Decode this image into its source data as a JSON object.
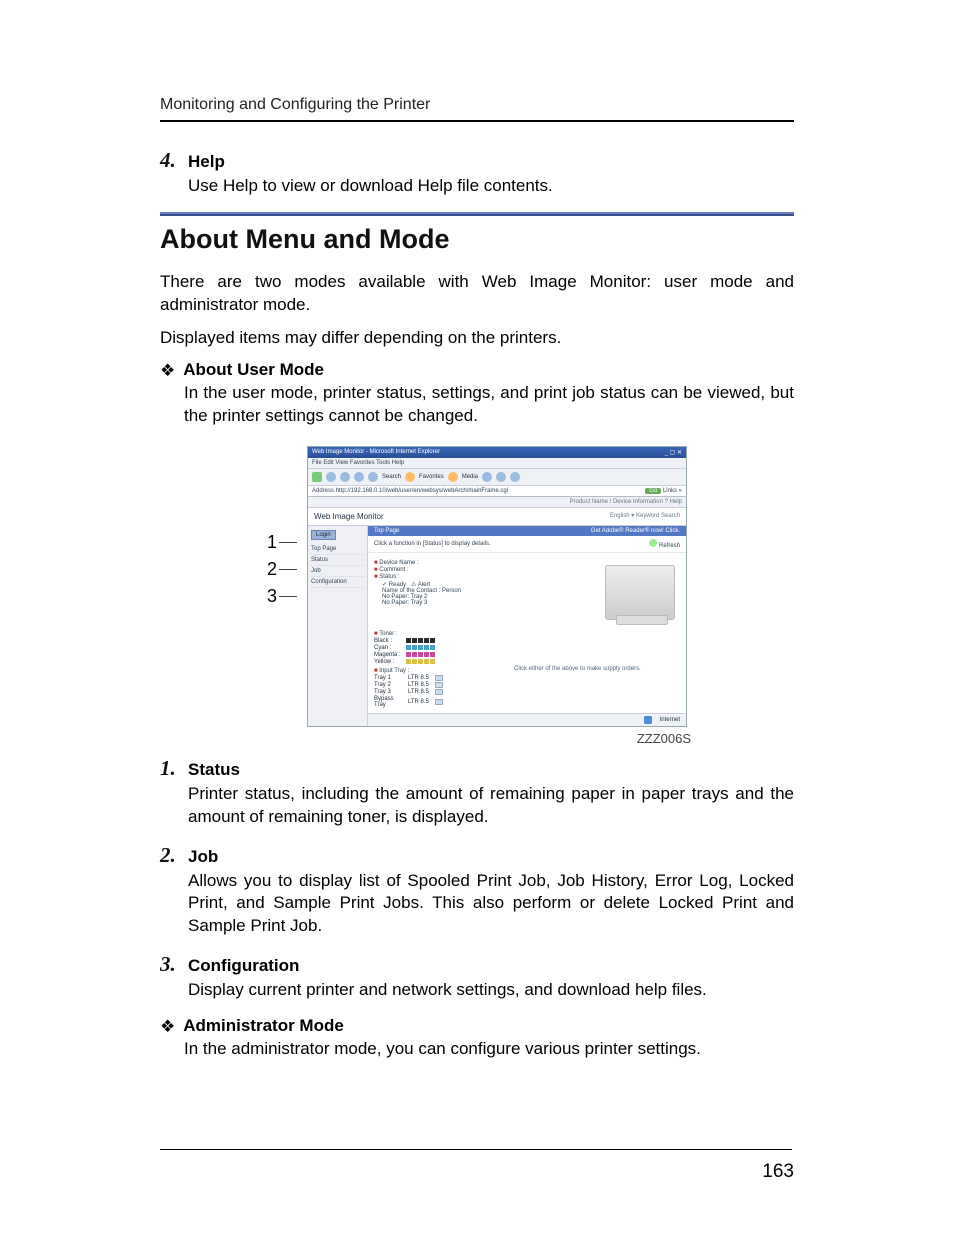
{
  "header": {
    "title": "Monitoring and Configuring the Printer"
  },
  "topItem": {
    "num": "4.",
    "title": "Help",
    "body": "Use Help to view or download Help file contents."
  },
  "section": {
    "title": "About Menu and Mode",
    "para1": "There are two modes available with Web Image Monitor: user mode and administrator mode.",
    "para2": "Displayed items may differ depending on the printers."
  },
  "userMode": {
    "title": "About User Mode",
    "body": "In the user mode, printer status, settings, and print job status can be viewed, but the printer settings cannot be changed."
  },
  "callouts": {
    "c1": "1",
    "c2": "2",
    "c3": "3"
  },
  "browser": {
    "title": "Web Image Monitor - Microsoft Internet Explorer",
    "menus": "File   Edit   View   Favorites   Tools   Help",
    "search": "Search",
    "favorites": "Favorites",
    "media": "Media",
    "url": "Address  http://192.168.0.10/web/user/en/websys/webArch/mainFrame.cgi",
    "go": "Go",
    "links": "Links",
    "hostline": "Product Name / Device Information       ? Help",
    "appTitle": "Web Image Monitor",
    "lang": "English ▾   Keyword Search",
    "loginBtn": "Login",
    "side1": "Top Page",
    "side2": "Status",
    "side3": "Job",
    "side4": "Configuration",
    "tab": "Top Page",
    "tabR": "Get Adobe® Reader® now! Click.",
    "note": "Click a function in [Status] to display details.",
    "refreshLbl": "Refresh",
    "f_device": "Device Name :",
    "f_comment": "Comment :",
    "f_status": "Status :",
    "f_ready": "Ready",
    "f_alert": "Alert",
    "f_contact": "Name of the Contact :  Person",
    "f_np1": "No Paper: Tray 2",
    "f_np2": "No Paper: Tray 3",
    "t_label": "Toner :",
    "t_black": "Black :",
    "t_cyan": "Cyan :",
    "t_magenta": "Magenta :",
    "t_yellow": "Yellow :",
    "tray_label": "Input Tray :",
    "tray1": "Tray 1",
    "tray2": "Tray 2",
    "tray3": "Tray 3",
    "trayB": "Bypass Tray",
    "tray_sz": "LTR   8.5",
    "hint": "Click either of the above to make supply orders.",
    "statusR": "Internet"
  },
  "figureId": "ZZZ006S",
  "numbered": {
    "n1": {
      "num": "1.",
      "title": "Status",
      "body": "Printer status, including the amount of remaining paper in paper trays and the amount of remaining toner, is displayed."
    },
    "n2": {
      "num": "2.",
      "title": "Job",
      "body": "Allows you to display list of Spooled Print Job, Job History, Error Log, Locked Print, and Sample Print Jobs. This also perform or delete Locked Print and Sample Print Job."
    },
    "n3": {
      "num": "3.",
      "title": "Configuration",
      "body": "Display current printer and network settings, and download help files."
    }
  },
  "adminMode": {
    "title": "Administrator Mode",
    "body": "In the administrator mode, you can configure various printer settings."
  },
  "pageNumber": "163",
  "tonerColors": {
    "black": "#2b2b2b",
    "cyan": "#4aa4c8",
    "magenta": "#c84a9a",
    "yellow": "#d8c04a"
  }
}
